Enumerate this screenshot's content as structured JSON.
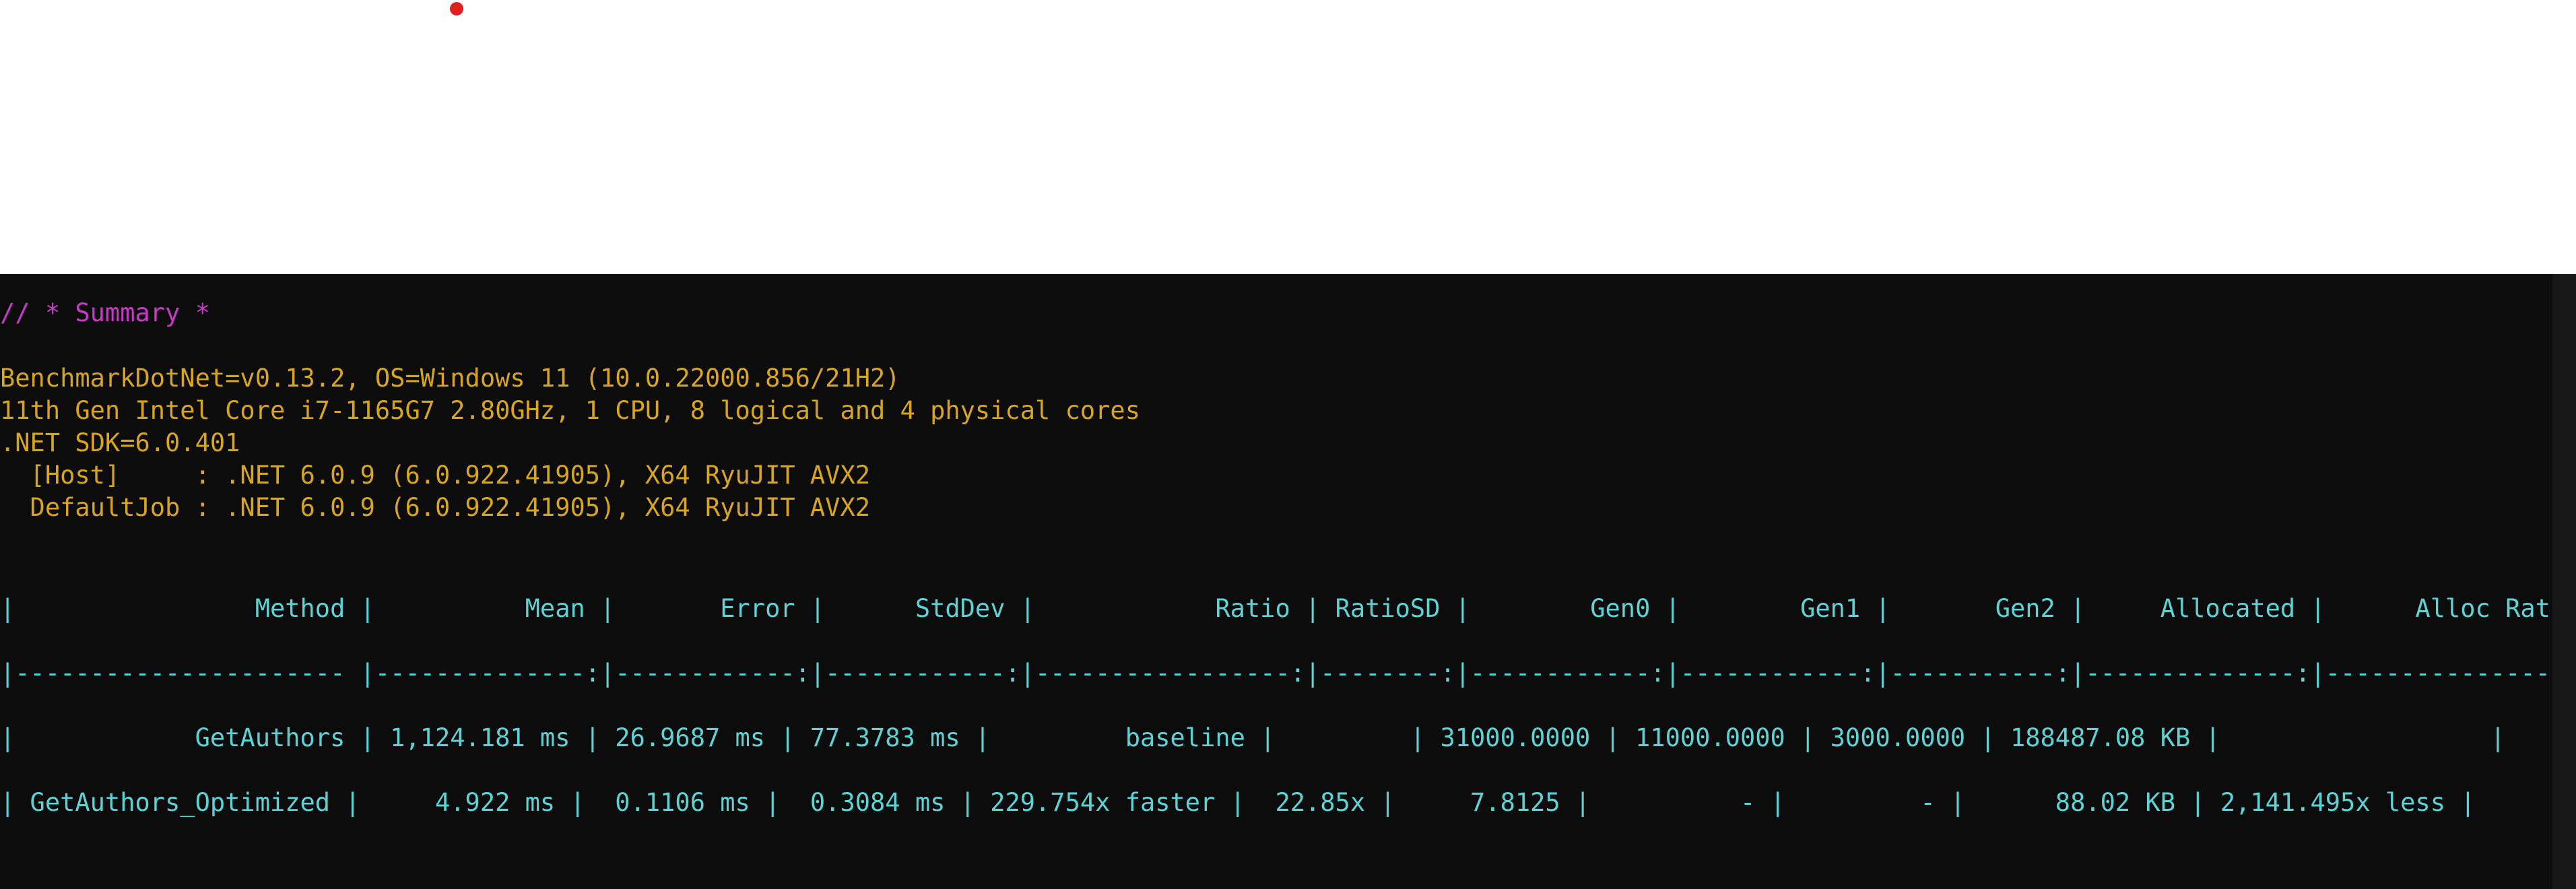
{
  "colors": {
    "terminal_bg": "#0c0c0c",
    "summary_color": "#c73ac7",
    "env_color": "#d9a51c",
    "table_color": "#5ed3d6",
    "marker_color": "#e02020"
  },
  "marker": {
    "icon": "red-dot-icon"
  },
  "terminal": {
    "summary_header": "// * Summary *",
    "env_lines": [
      "BenchmarkDotNet=v0.13.2, OS=Windows 11 (10.0.22000.856/21H2)",
      "11th Gen Intel Core i7-1165G7 2.80GHz, 1 CPU, 8 logical and 4 physical cores",
      ".NET SDK=6.0.401",
      "  [Host]     : .NET 6.0.9 (6.0.922.41905), X64 RyuJIT AVX2",
      "  DefaultJob : .NET 6.0.9 (6.0.922.41905), X64 RyuJIT AVX2"
    ],
    "table_lines": [
      "|                Method |          Mean |       Error |      StdDev |            Ratio | RatioSD |        Gen0 |        Gen1 |       Gen2 |     Allocated |      Alloc Ratio |",
      "|---------------------- |--------------:|------------:|------------:|-----------------:|--------:|------------:|------------:|-----------:|--------------:|-----------------:|",
      "|            GetAuthors | 1,124.181 ms | 26.9687 ms | 77.3783 ms |         baseline |         | 31000.0000 | 11000.0000 | 3000.0000 | 188487.08 KB |                  |",
      "| GetAuthors_Optimized |     4.922 ms |  0.1106 ms |  0.3084 ms | 229.754x faster |  22.85x |     7.8125 |          - |         - |      88.02 KB | 2,141.495x less |"
    ]
  }
}
